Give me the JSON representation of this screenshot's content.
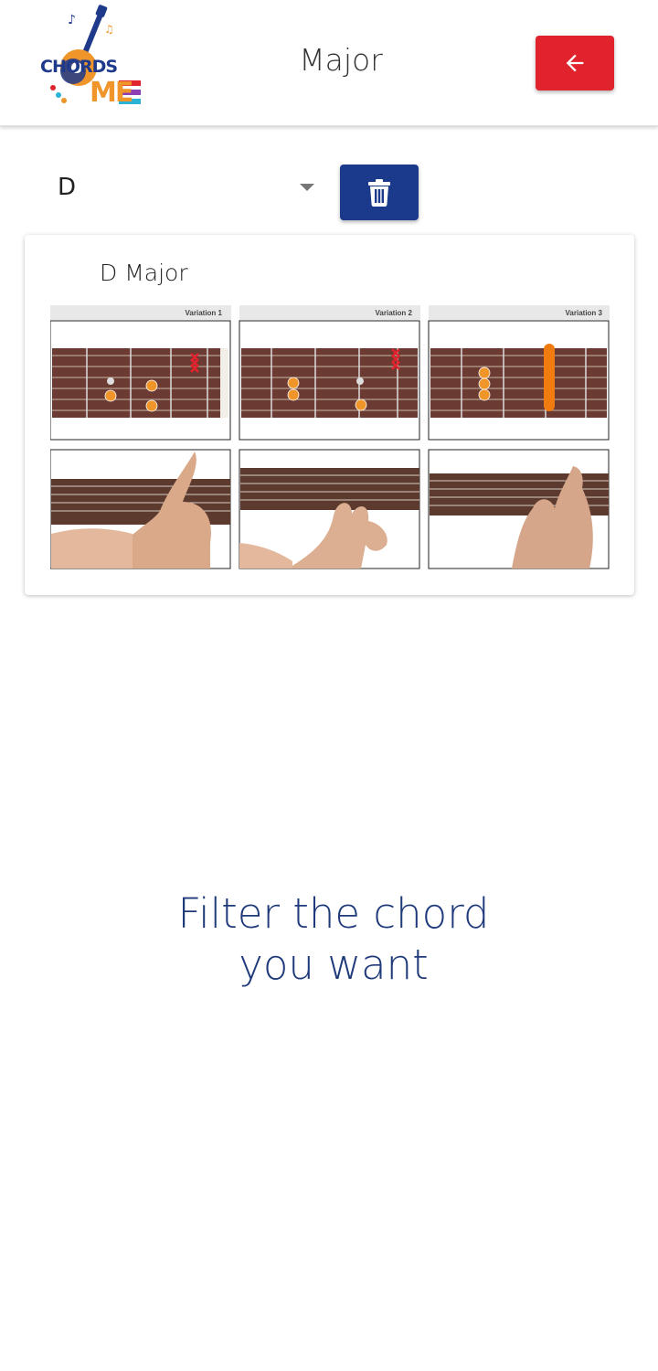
{
  "header": {
    "logo_text": "CHORDS",
    "logo_me": "ME",
    "title": "Major",
    "back_icon": "arrow-left-icon"
  },
  "filter": {
    "selected_key": "D",
    "delete_icon": "trash-icon"
  },
  "card": {
    "title": "D Major",
    "variations": [
      "Variation 1",
      "Variation 2",
      "Variation 3"
    ]
  },
  "cta": {
    "line1": "Filter the chord",
    "line2": "you want"
  },
  "colors": {
    "back_button": "#e0232d",
    "delete_button": "#1c3a8c",
    "cta_text": "#1f3a7a",
    "finger_dot": "#f0952a"
  }
}
